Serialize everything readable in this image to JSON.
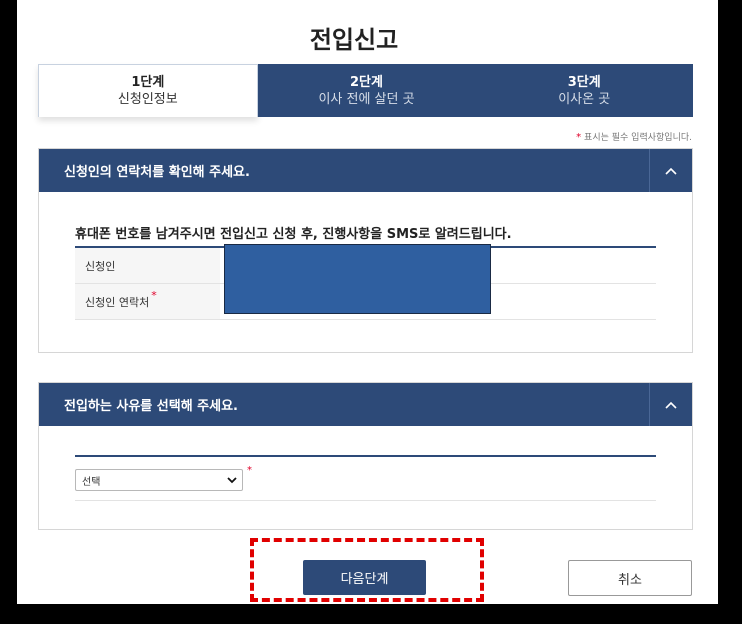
{
  "page": {
    "title": "전입신고"
  },
  "steps": [
    {
      "num": "1단계",
      "label": "신청인정보"
    },
    {
      "num": "2단계",
      "label": "이사 전에 살던 곳"
    },
    {
      "num": "3단계",
      "label": "이사온 곳"
    }
  ],
  "required_note": {
    "star": "*",
    "text": "표시는 필수 입력사항입니다."
  },
  "section1": {
    "title": "신청인의 연락처를 확인해 주세요.",
    "info_text": "휴대폰 번호를 남겨주시면 전입신고 신청 후, 진행사항을 SMS로 알려드립니다.",
    "rows": [
      {
        "label": "신청인",
        "required": ""
      },
      {
        "label": "신청인 연락처",
        "required": "*"
      }
    ]
  },
  "section2": {
    "title": "전입하는 사유를 선택해 주세요.",
    "select_value": "선택",
    "required": "*"
  },
  "buttons": {
    "next": "다음단계",
    "cancel": "취소"
  },
  "colors": {
    "primary": "#2d4a78",
    "required": "#e0002a",
    "highlight": "#e00000",
    "redaction": "#2f5fa0"
  },
  "icons": {
    "toggle": "chevron-up-icon",
    "select": "chevron-down-icon"
  }
}
